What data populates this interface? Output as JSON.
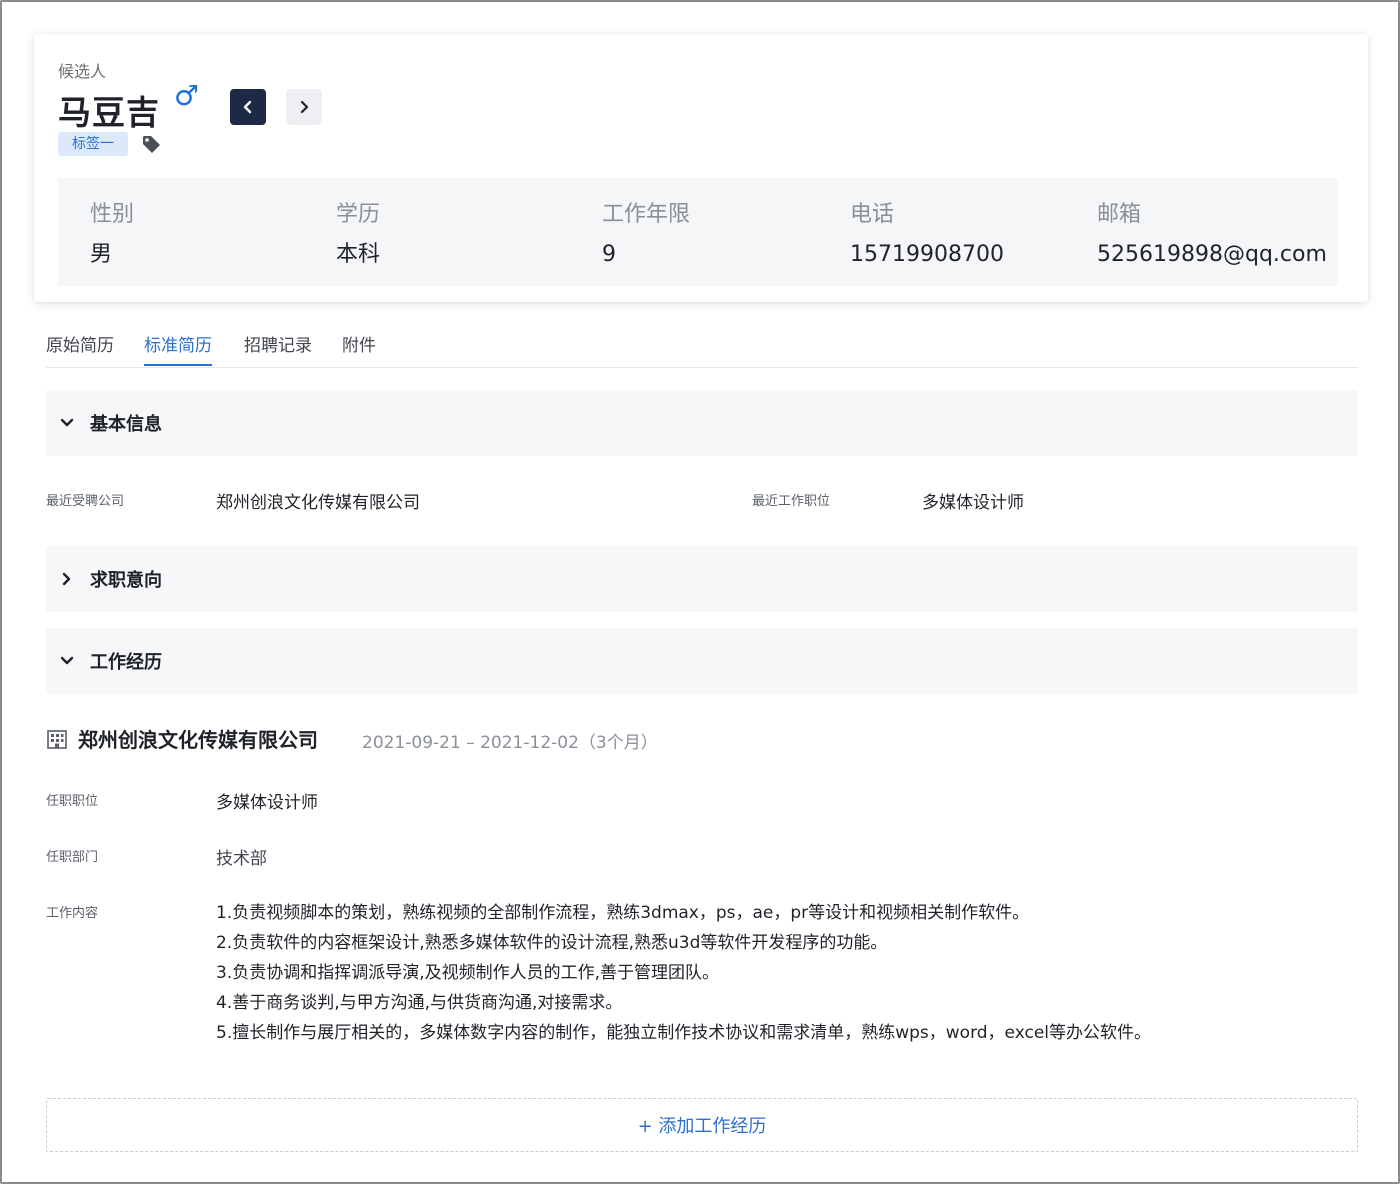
{
  "candidate": {
    "label": "候选人",
    "name": "马豆吉",
    "gender_icon": "male-icon",
    "gender_symbol": "♂",
    "tag": "标签一"
  },
  "summary": [
    {
      "label": "性别",
      "value": "男"
    },
    {
      "label": "学历",
      "value": "本科"
    },
    {
      "label": "工作年限",
      "value": "9"
    },
    {
      "label": "电话",
      "value": "15719908700"
    },
    {
      "label": "邮箱",
      "value": "525619898@qq.com"
    }
  ],
  "tabs": [
    {
      "label": "原始简历",
      "active": false
    },
    {
      "label": "标准简历",
      "active": true
    },
    {
      "label": "招聘记录",
      "active": false
    },
    {
      "label": "附件",
      "active": false
    }
  ],
  "basic_info": {
    "title": "基本信息",
    "expanded": true,
    "recent_company_label": "最近受聘公司",
    "recent_company": "郑州创浪文化传媒有限公司",
    "recent_position_label": "最近工作职位",
    "recent_position": "多媒体设计师"
  },
  "job_intention": {
    "title": "求职意向",
    "expanded": false
  },
  "work_experience": {
    "title": "工作经历",
    "expanded": true,
    "entries": [
      {
        "company": "郑州创浪文化传媒有限公司",
        "dates": "2021-09-21 – 2021-12-02（3个月）",
        "position_label": "任职职位",
        "position": "多媒体设计师",
        "department_label": "任职部门",
        "department": "技术部",
        "content_label": "工作内容",
        "content": [
          "1.负责视频脚本的策划，熟练视频的全部制作流程，熟练3dmax，ps，ae，pr等设计和视频相关制作软件。",
          "2.负责软件的内容框架设计,熟悉多媒体软件的设计流程,熟悉u3d等软件开发程序的功能。",
          "3.负责协调和指挥调派导演,及视频制作人员的工作,善于管理团队。",
          "4.善于商务谈判,与甲方沟通,与供货商沟通,对接需求。",
          "5.擅长制作与展厅相关的，多媒体数字内容的制作，能独立制作技术协议和需求清单，熟练wps，word，excel等办公软件。"
        ]
      }
    ],
    "add_label": "+ 添加工作经历"
  },
  "colors": {
    "accent": "#2c71d1",
    "nav_dark": "#1d2a45",
    "panel_bg": "#f5f6f8"
  }
}
